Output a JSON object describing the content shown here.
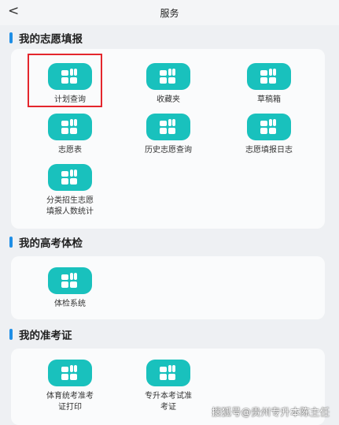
{
  "header": {
    "back_glyph": "<",
    "title": "服务"
  },
  "sections": {
    "application": {
      "title": "我的志愿填报",
      "items": {
        "plan_query": "计划查询",
        "favorites": "收藏夹",
        "drafts": "草稿箱",
        "volunteer_table": "志愿表",
        "history_query": "历史志愿查询",
        "application_log": "志愿填报日志",
        "category_stats_line1": "分类招生志愿",
        "category_stats_line2": "填报人数统计"
      }
    },
    "exam": {
      "title": "我的高考体检",
      "items": {
        "physical_exam_system": "体检系统"
      }
    },
    "admission": {
      "title": "我的准考证",
      "items": {
        "pe_ticket_line1": "体育统考准考",
        "pe_ticket_line2": "证打印",
        "upgrade_ticket_line1": "专升本考试准",
        "upgrade_ticket_line2": "考证"
      }
    }
  },
  "watermark": "搜狐号@贵州专升本陈主任",
  "colors": {
    "accent": "#19c1bd",
    "section_bar": "#1e8ee6",
    "highlight": "#e4262d"
  },
  "icons": {
    "back": "chevron-left-icon",
    "tile": "grid-apps-icon"
  }
}
